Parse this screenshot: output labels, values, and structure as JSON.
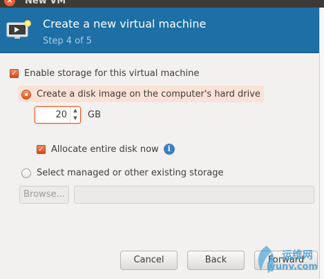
{
  "window": {
    "title": "New VM",
    "close_glyph": "×"
  },
  "header": {
    "title": "Create a new virtual machine",
    "step": "Step 4 of 5",
    "icon": "monitor-icon"
  },
  "storage": {
    "enable_label": "Enable storage for this virtual machine",
    "enable_checked": true,
    "create_disk_label": "Create a disk image on the computer's hard drive",
    "create_disk_selected": true,
    "size_value": "20",
    "size_unit": "GB",
    "allocate_label": "Allocate entire disk now",
    "allocate_checked": true,
    "existing_label": "Select managed or other existing storage",
    "existing_selected": false,
    "browse_label": "Browse...",
    "path_value": ""
  },
  "buttons": {
    "cancel": "Cancel",
    "back": "Back",
    "forward": "Forward"
  },
  "watermark": {
    "cn": "运维网",
    "url": "iyunv.com"
  },
  "colors": {
    "header_bg": "#1d6fa5",
    "accent": "#e5541b",
    "highlight": "#fbe2d6"
  }
}
